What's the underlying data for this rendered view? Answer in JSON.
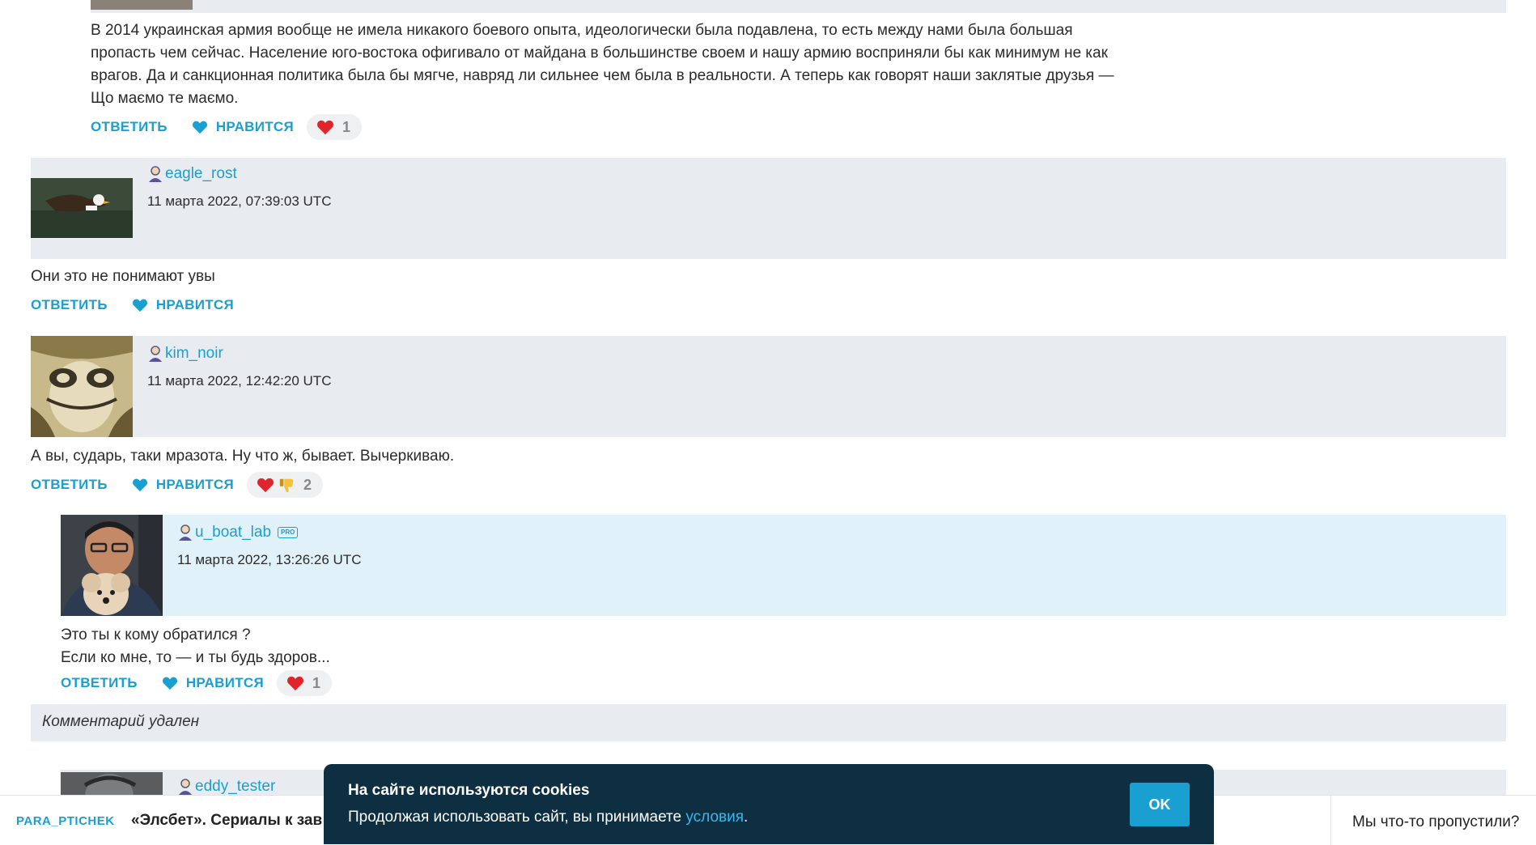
{
  "labels": {
    "reply": "ОТВЕТИТЬ",
    "like": "НРАВИТСЯ",
    "pro": "PRO"
  },
  "top_comment": {
    "text": "В 2014 украинская армия вообще не имела никакого боевого опыта, идеологически была подавлена, то есть между нами была большая\nпропасть чем сейчас. Население юго-востока офигивало от майдана в большинстве своем и нашу армию восприняли бы как минимум не как\nврагов. Да и санкционная политика была бы мягче, навряд ли сильнее чем была в реальности. А теперь как говорят наши заклятые друзья —\nЩо маємо те маємо.",
    "reactions_count": "1"
  },
  "comments": [
    {
      "username": "eagle_rost",
      "timestamp": "11 марта 2022, 07:39:03 UTC",
      "text": "Они это не понимают увы"
    },
    {
      "username": "kim_noir",
      "timestamp": "11 марта 2022, 12:42:20 UTC",
      "text": "А вы, сударь, таки мразота. Ну что ж, бывает. Вычеркиваю.",
      "reactions_count": "2"
    },
    {
      "username": "u_boat_lab",
      "timestamp": "11 марта 2022, 13:26:26 UTC",
      "text": "Это ты к кому обратился ?\nЕсли ко мне, то — и ты будь здоров...",
      "reactions_count": "1"
    },
    {
      "username": "eddy_tester"
    }
  ],
  "deleted_comment": "Комментарий удален",
  "footer": {
    "author": "PARA_PTICHEK",
    "title": "«Элсбет». Сериалы к зав",
    "right_text": "Мы что-то пропустили?"
  },
  "cookie": {
    "title": "На сайте используются cookies",
    "text": "Продолжая использовать сайт, вы принимаете ",
    "link": "условия",
    "suffix": ".",
    "ok": "OK"
  },
  "colors": {
    "accent": "#1a9fd1",
    "cookie_bg": "#0d2f41",
    "header_bg": "#e8ecf0",
    "pro_header_bg": "#e1f1f9"
  }
}
